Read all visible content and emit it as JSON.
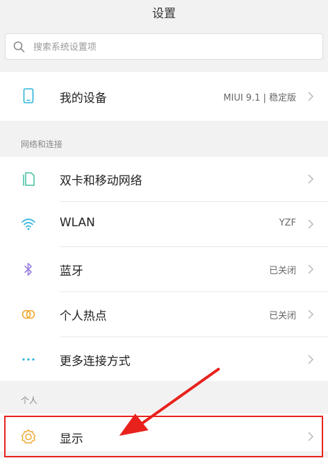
{
  "header": {
    "title": "设置"
  },
  "search": {
    "placeholder": "搜索系统设置项"
  },
  "device": {
    "label": "我的设备",
    "value": "MIUI 9.1 | 稳定版"
  },
  "sections": {
    "network": "网络和连接",
    "personal": "个人"
  },
  "network_items": [
    {
      "label": "双卡和移动网络",
      "value": ""
    },
    {
      "label": "WLAN",
      "value": "YZF"
    },
    {
      "label": "蓝牙",
      "value": "已关闭"
    },
    {
      "label": "个人热点",
      "value": "已关闭"
    },
    {
      "label": "更多连接方式",
      "value": ""
    }
  ],
  "personal_items": [
    {
      "label": "显示"
    }
  ],
  "colors": {
    "annotation_red": "#e8211c",
    "icon_blue": "#2ab3d9",
    "icon_green": "#3dbfa0",
    "icon_purple": "#9b7fe0",
    "icon_orange": "#f0a52a"
  }
}
